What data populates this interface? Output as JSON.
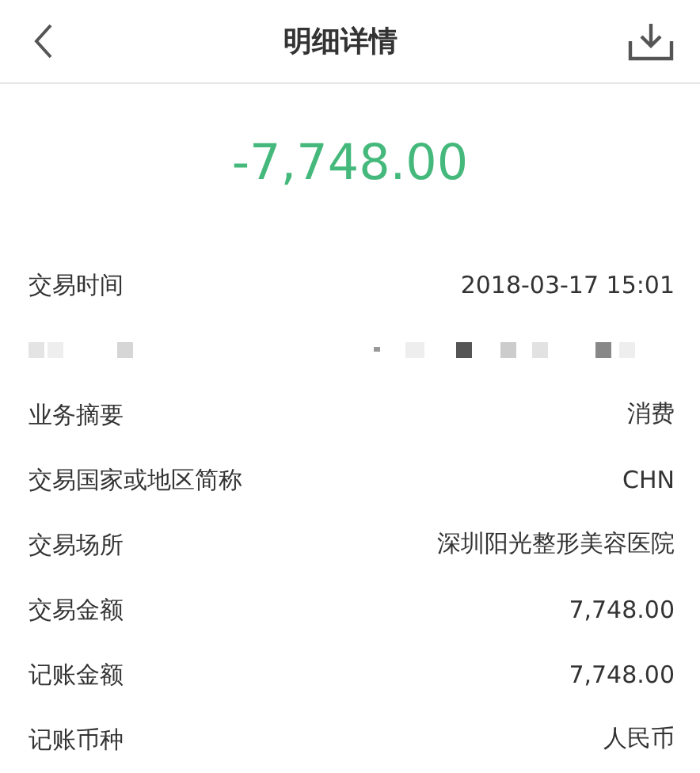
{
  "header": {
    "title": "明细详情"
  },
  "amount": "-7,748.00",
  "rows": [
    {
      "kind": "field",
      "label": "交易时间",
      "value": "2018-03-17 15:01"
    },
    {
      "kind": "redacted"
    },
    {
      "kind": "field",
      "label": "业务摘要",
      "value": "消费"
    },
    {
      "kind": "field",
      "label": "交易国家或地区简称",
      "value": "CHN"
    },
    {
      "kind": "field",
      "label": "交易场所",
      "value": "深圳阳光整形美容医院"
    },
    {
      "kind": "field",
      "label": "交易金额",
      "value": "7,748.00"
    },
    {
      "kind": "field",
      "label": "记账金额",
      "value": "7,748.00"
    },
    {
      "kind": "field",
      "label": "记账币种",
      "value": "人民币"
    }
  ]
}
